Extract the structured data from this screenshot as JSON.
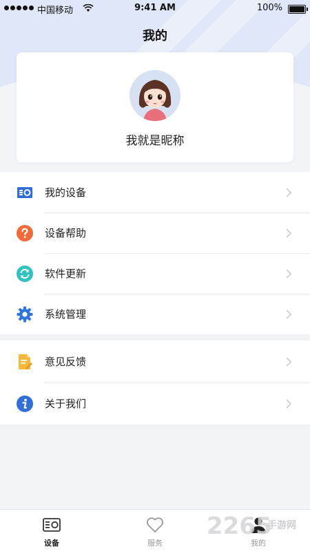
{
  "status_bar": {
    "carrier": "中国移动",
    "time": "9:41 AM",
    "battery": "100%"
  },
  "page": {
    "title": "我的"
  },
  "profile": {
    "nickname": "我就是昵称"
  },
  "menu": {
    "group1": [
      {
        "label": "我的设备",
        "icon": "device-icon",
        "color": "#2f6fd6"
      },
      {
        "label": "设备帮助",
        "icon": "question-icon",
        "color": "#f06a3a"
      },
      {
        "label": "软件更新",
        "icon": "refresh-icon",
        "color": "#31c2c0"
      },
      {
        "label": "系统管理",
        "icon": "gear-icon",
        "color": "#2f74e0"
      }
    ],
    "group2": [
      {
        "label": "意见反馈",
        "icon": "feedback-icon",
        "color": "#f5b83a"
      },
      {
        "label": "关于我们",
        "icon": "info-icon",
        "color": "#2f6fd6"
      }
    ]
  },
  "tabs": [
    {
      "label": "设备",
      "icon": "device-icon",
      "active": true
    },
    {
      "label": "服务",
      "icon": "heart-icon",
      "active": false
    },
    {
      "label": "我的",
      "icon": "person-icon",
      "active": false
    }
  ],
  "watermark": {
    "text": "2265",
    "subtext": "手游网"
  },
  "colors": {
    "header_bg": "#dfe7f8",
    "page_bg": "#f3f4f8",
    "accent": "#2f6fd6"
  }
}
